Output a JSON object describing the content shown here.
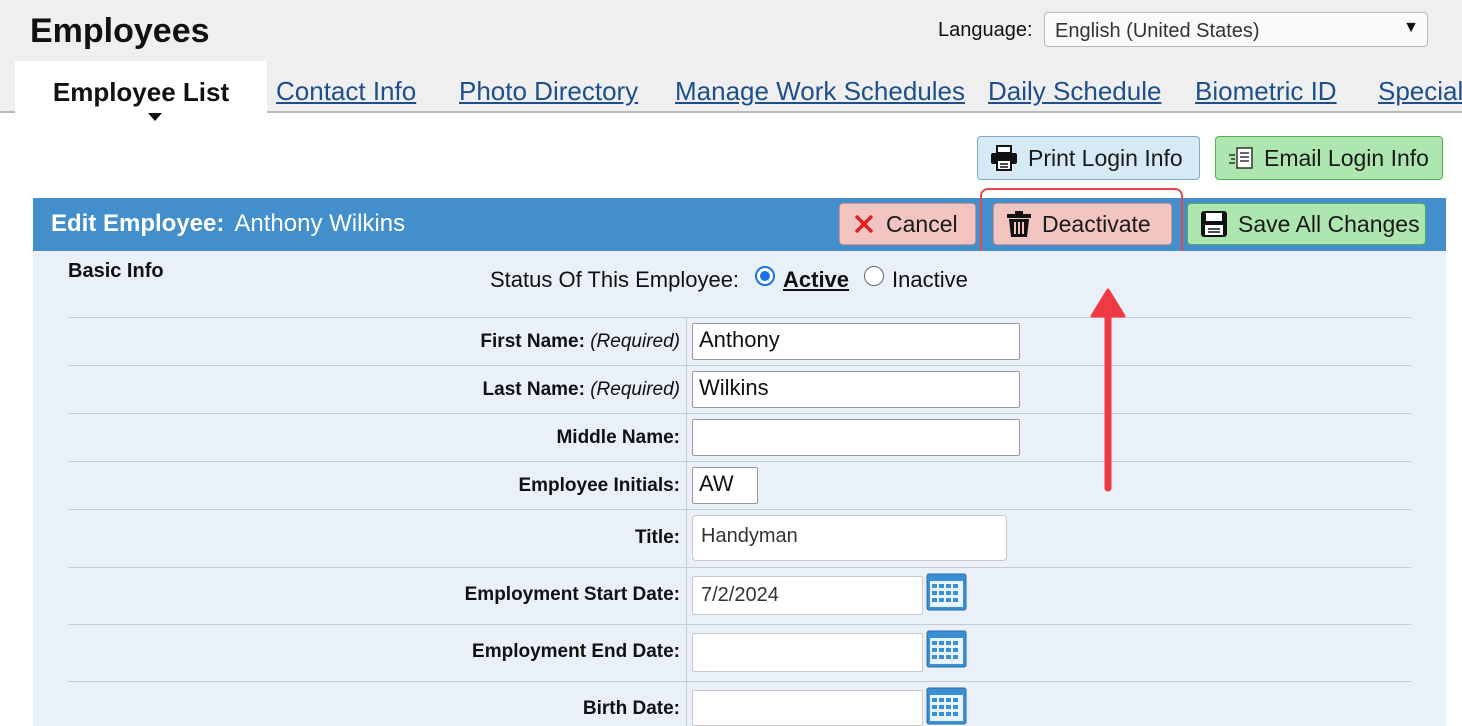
{
  "header": {
    "title": "Employees",
    "language_label": "Language:",
    "language_value": "English (United States)"
  },
  "tabs": [
    {
      "label": "Employee List",
      "active": true
    },
    {
      "label": "Contact Info"
    },
    {
      "label": "Photo Directory"
    },
    {
      "label": "Manage Work Schedules"
    },
    {
      "label": "Daily Schedule"
    },
    {
      "label": "Biometric ID"
    },
    {
      "label": "Special"
    }
  ],
  "actions": {
    "print_login": "Print Login Info",
    "email_login": "Email Login Info"
  },
  "edit_panel": {
    "heading": "Edit Employee:",
    "employee_name": "Anthony Wilkins",
    "cancel": "Cancel",
    "deactivate": "Deactivate",
    "save": "Save All Changes"
  },
  "basic_info": {
    "section_title": "Basic Info",
    "status_label": "Status Of This Employee:",
    "status_active": "Active",
    "status_inactive": "Inactive",
    "status_selected": "Active"
  },
  "form": {
    "required_tag": "(Required)",
    "first_name_label": "First Name:",
    "first_name_value": "Anthony",
    "last_name_label": "Last Name:",
    "last_name_value": "Wilkins",
    "middle_name_label": "Middle Name:",
    "middle_name_value": "",
    "initials_label": "Employee Initials:",
    "initials_value": "AW",
    "title_label": "Title:",
    "title_value": "Handyman",
    "start_date_label": "Employment Start Date:",
    "start_date_value": "7/2/2024",
    "end_date_label": "Employment End Date:",
    "end_date_value": "",
    "birth_date_label": "Birth Date:",
    "birth_date_value": ""
  },
  "colors": {
    "header_blue": "#428fcc",
    "panel_bg": "#e9f0f8",
    "cancel_bg": "#f3c5c1",
    "save_bg": "#aee6b0",
    "annotation_red": "#e3474c"
  }
}
